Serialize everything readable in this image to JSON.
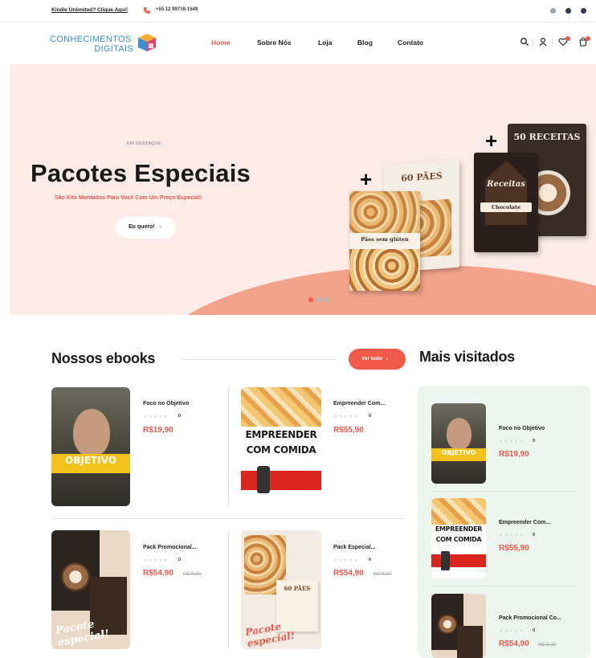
{
  "topbar": {
    "promo": "Kindle Unlimited? Clique Aqui!",
    "phone": "+55 12 99716-1549",
    "social_icons": [
      "facebook-icon",
      "instagram-icon",
      "pinterest-icon"
    ]
  },
  "header": {
    "logo_line1": "CONHECIMENTOS",
    "logo_line2": "DIGITAIS",
    "nav": [
      "Home",
      "Sobre Nós",
      "Loja",
      "Blog",
      "Contato"
    ],
    "active_nav": "Home",
    "icons": [
      "search-icon",
      "user-icon",
      "heart-icon",
      "cart-icon"
    ]
  },
  "hero": {
    "kicker": "EM DESTAQUE",
    "title": "Pacotes Especiais",
    "subtitle": "São Kits Montados Para Você Com Um Preço Especial!",
    "button_label": "Eu quero!",
    "book1_title": "60 PÃES",
    "book2_title": "50 RECEITAS",
    "book3_title": "Receitas",
    "book3_label": "Chocolate",
    "book4_label": "Pães sem glúten",
    "slide_count": 3,
    "active_slide": 1
  },
  "section": {
    "title": "Nossos ebooks",
    "see_all": "Ver tudo",
    "side_title": "Mais visitados"
  },
  "products": [
    {
      "name": "Foco no Objetivo",
      "reviews": "0",
      "price": "R$19,90",
      "old_price": ""
    },
    {
      "name": "Empreender Com...",
      "reviews": "0",
      "price": "R$55,90",
      "old_price": ""
    },
    {
      "name": "Pack Promocional...",
      "reviews": "0",
      "price": "R$54,90",
      "old_price": "R$76,80"
    },
    {
      "name": "Pack Especial...",
      "reviews": "0",
      "price": "R$54,90",
      "old_price": "R$76,80"
    }
  ],
  "most_visited": [
    {
      "name": "Foco no Objetivo",
      "reviews": "0",
      "price": "R$19,90",
      "old_price": ""
    },
    {
      "name": "Empreender Com...",
      "reviews": "0",
      "price": "R$55,90",
      "old_price": ""
    },
    {
      "name": "Pack Promocional Co...",
      "reviews": "0",
      "price": "R$54,90",
      "old_price": "R$76,80"
    }
  ],
  "cover_text": {
    "objetivo": "OBJETIVO",
    "empreender_line1": "EMPREENDER",
    "empreender_line2": "COM COMIDA",
    "pacote": "Pacote especial!",
    "chocolate": "Chocolate",
    "sixty_paes": "60 PÃES"
  },
  "colors": {
    "accent": "#f15a4a",
    "hero_bg": "#fcebe6",
    "hero_wave": "#f2a38a",
    "side_bg": "#edf6ee",
    "logo_blue": "#3a8fd6"
  }
}
